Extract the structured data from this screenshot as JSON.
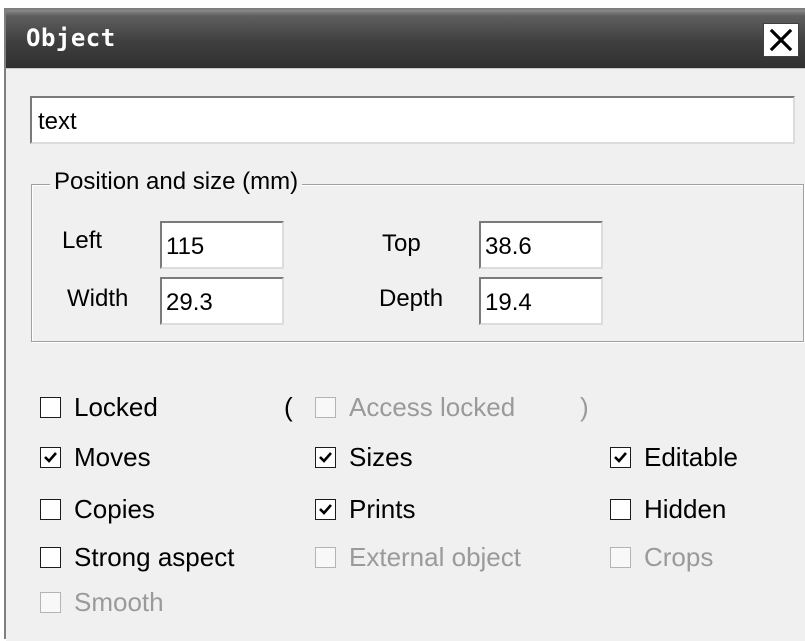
{
  "window": {
    "title": "Object"
  },
  "name_field": {
    "value": "text"
  },
  "position_group": {
    "legend": "Position and size (mm)",
    "left_label": "Left",
    "left_value": "115",
    "top_label": "Top",
    "top_value": "38.6",
    "width_label": "Width",
    "width_value": "29.3",
    "depth_label": "Depth",
    "depth_value": "19.4"
  },
  "options": {
    "locked": {
      "label": "Locked",
      "checked": false,
      "enabled": true
    },
    "open_paren": "(",
    "access_locked": {
      "label": "Access locked",
      "checked": false,
      "enabled": false
    },
    "close_paren": ")",
    "moves": {
      "label": "Moves",
      "checked": true,
      "enabled": true
    },
    "sizes": {
      "label": "Sizes",
      "checked": true,
      "enabled": true
    },
    "editable": {
      "label": "Editable",
      "checked": true,
      "enabled": true
    },
    "copies": {
      "label": "Copies",
      "checked": false,
      "enabled": true
    },
    "prints": {
      "label": "Prints",
      "checked": true,
      "enabled": true
    },
    "hidden": {
      "label": "Hidden",
      "checked": false,
      "enabled": true
    },
    "strong_aspect": {
      "label": "Strong aspect",
      "checked": false,
      "enabled": true
    },
    "external_object": {
      "label": "External object",
      "checked": false,
      "enabled": false
    },
    "crops": {
      "label": "Crops",
      "checked": false,
      "enabled": false
    },
    "smooth": {
      "label": "Smooth",
      "checked": false,
      "enabled": false
    }
  },
  "icons": {
    "close": "close-icon",
    "check": "checkmark-icon"
  }
}
